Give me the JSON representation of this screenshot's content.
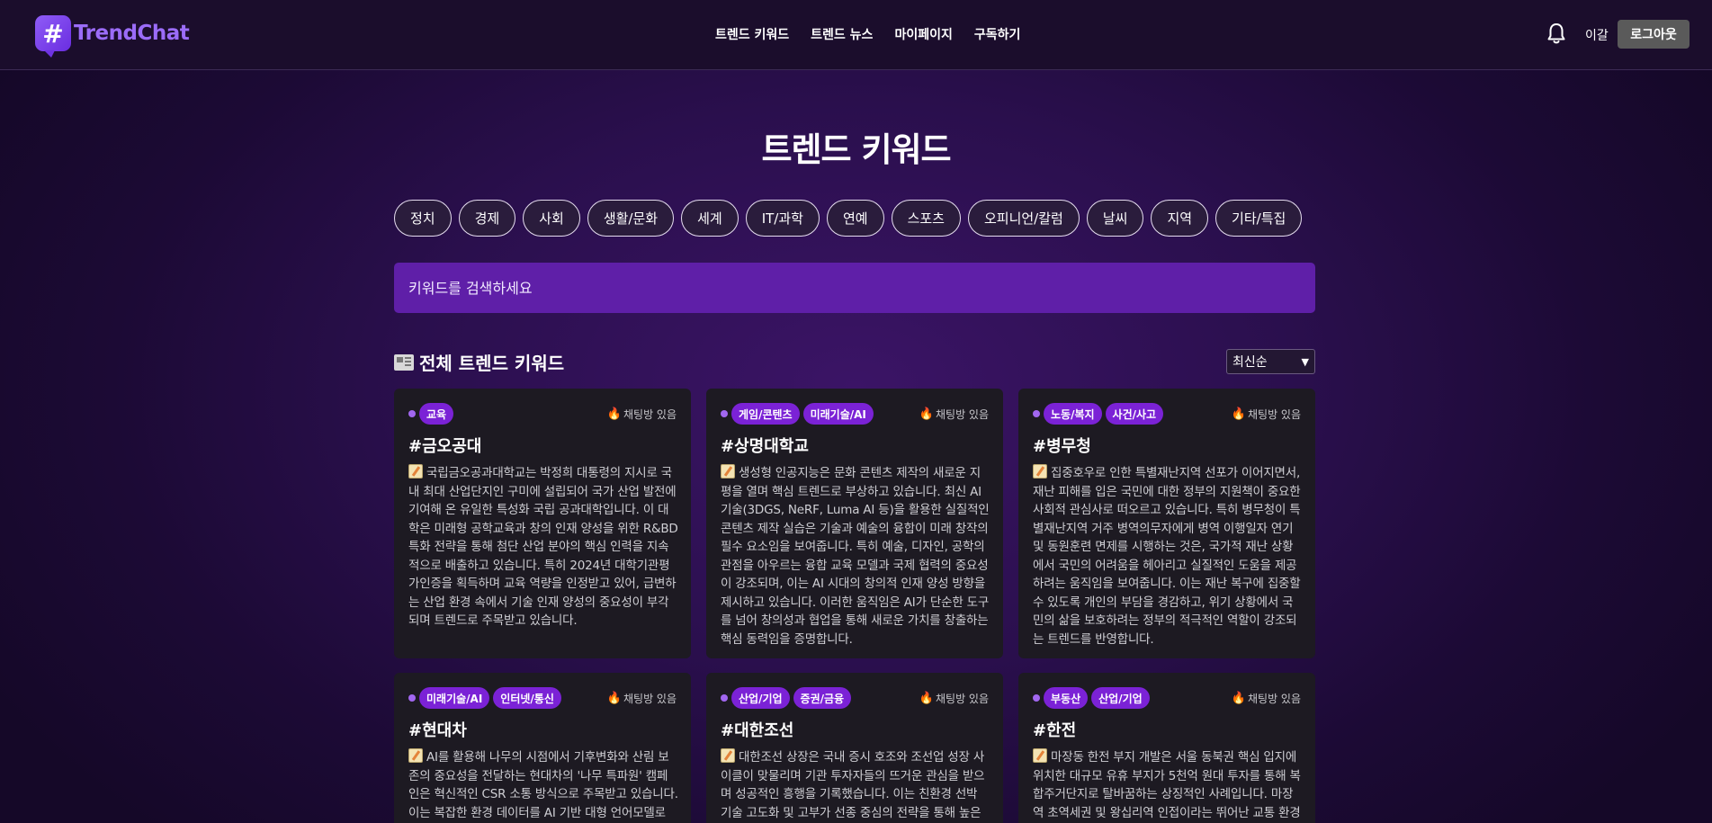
{
  "header": {
    "logo_text": "TrendChat",
    "logo_glyph": "#",
    "nav": [
      "트렌드 키워드",
      "트렌드 뉴스",
      "마이페이지",
      "구독하기"
    ],
    "user_name": "이갈",
    "logout_label": "로그아웃"
  },
  "main": {
    "title": "트렌드 키워드",
    "categories": [
      "정치",
      "경제",
      "사회",
      "생활/문화",
      "세계",
      "IT/과학",
      "연예",
      "스포츠",
      "오피니언/칼럼",
      "날씨",
      "지역",
      "기타/특집"
    ],
    "search_placeholder": "키워드를 검색하세요",
    "section_title": "전체 트렌드 키워드",
    "sort_selected": "최신순",
    "chat_label": "채팅방 있음",
    "cards": [
      {
        "tags": [
          "교육"
        ],
        "title": "#금오공대",
        "body": "국립금오공과대학교는 박정희 대통령의 지시로 국내 최대 산업단지인 구미에 설립되어 국가 산업 발전에 기여해 온 유일한 특성화 국립 공과대학입니다. 이 대학은 미래형 공학교육과 창의 인재 양성을 위한 R&BD 특화 전략을 통해 첨단 산업 분야의 핵심 인력을 지속적으로 배출하고 있습니다. 특히 2024년 대학기관평가인증을 획득하며 교육 역량을 인정받고 있어, 급변하는 산업 환경 속에서 기술 인재 양성의 중요성이 부각되며 트렌드로 주목받고 있습니다."
      },
      {
        "tags": [
          "게임/콘텐츠",
          "미래기술/AI"
        ],
        "title": "#상명대학교",
        "body": "생성형 인공지능은 문화 콘텐츠 제작의 새로운 지평을 열며 핵심 트렌드로 부상하고 있습니다. 최신 AI 기술(3DGS, NeRF, Luma AI 등)을 활용한 실질적인 콘텐츠 제작 실습은 기술과 예술의 융합이 미래 창작의 필수 요소임을 보여줍니다. 특히 예술, 디자인, 공학의 관점을 아우르는 융합 교육 모델과 국제 협력의 중요성이 강조되며, 이는 AI 시대의 창의적 인재 양성 방향을 제시하고 있습니다. 이러한 움직임은 AI가 단순한 도구를 넘어 창의성과 협업을 통해 새로운 가치를 창출하는 핵심 동력임을 증명합니다."
      },
      {
        "tags": [
          "노동/복지",
          "사건/사고"
        ],
        "title": "#병무청",
        "body": "집중호우로 인한 특별재난지역 선포가 이어지면서, 재난 피해를 입은 국민에 대한 정부의 지원책이 중요한 사회적 관심사로 떠오르고 있습니다. 특히 병무청이 특별재난지역 거주 병역의무자에게 병역 이행일자 연기 및 동원훈련 면제를 시행하는 것은, 국가적 재난 상황에서 국민의 어려움을 헤아리고 실질적인 도움을 제공하려는 움직임을 보여줍니다. 이는 재난 복구에 집중할 수 있도록 개인의 부담을 경감하고, 위기 상황에서 국민의 삶을 보호하려는 정부의 적극적인 역할이 강조되는 트렌드를 반영합니다."
      },
      {
        "tags": [
          "미래기술/AI",
          "인터넷/통신"
        ],
        "title": "#현대차",
        "body": "AI를 활용해 나무의 시점에서 기후변화와 산림 보존의 중요성을 전달하는 현대차의 '나무 특파원' 캠페인은 혁신적인 CSR 소통 방식으로 주목받고 있습니다. 이는 복잡한 환경 데이터를 AI 기반 대형 언어모델로 분"
      },
      {
        "tags": [
          "산업/기업",
          "증권/금융"
        ],
        "title": "#대한조선",
        "body": "대한조선 상장은 국내 증시 호조와 조선업 성장 사이클이 맞물리며 기관 투자자들의 뜨거운 관심을 받으며 성공적인 흥행을 기록했습니다. 이는 친환경 선박 기술 고도화 및 고부가 선종 중심의 전략을 통해 높은 수"
      },
      {
        "tags": [
          "부동산",
          "산업/기업"
        ],
        "title": "#한전",
        "body": "마장동 한전 부지 개발은 서울 동북권 핵심 입지에 위치한 대규모 유휴 부지가 5천억 원대 투자를 통해 복합주거단지로 탈바꿈하는 상징적인 사례입니다. 마장역 초역세권 및 왕십리역 인접이라는 뛰어난 교통 환경과"
      }
    ]
  }
}
